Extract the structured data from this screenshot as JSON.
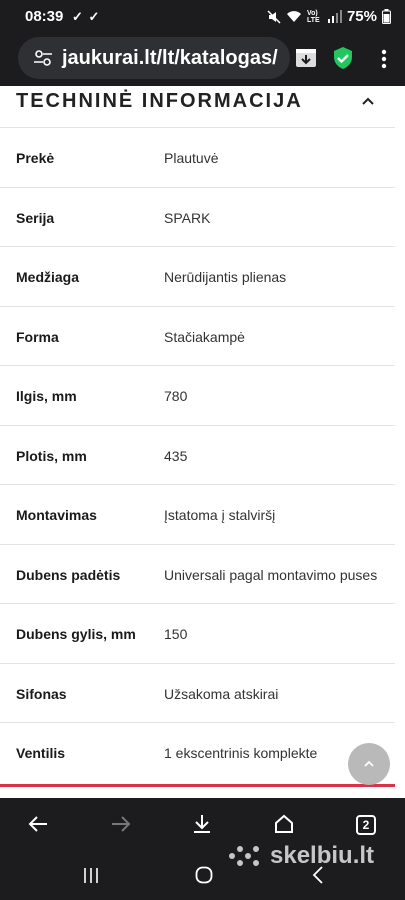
{
  "status_bar": {
    "time": "08:39",
    "notification_checks": "✓ ✓",
    "battery": "75%",
    "network_label": "Vo) LTE"
  },
  "browser": {
    "url": "jaukurai.lt/lt/katalogas/",
    "open_tabs": "2"
  },
  "section": {
    "title": "TECHNINĖ INFORMACIJA"
  },
  "specs": [
    {
      "label": "Prekė",
      "value": "Plautuvė"
    },
    {
      "label": "Serija",
      "value": "SPARK"
    },
    {
      "label": "Medžiaga",
      "value": "Nerūdijantis plienas"
    },
    {
      "label": "Forma",
      "value": "Stačiakampė"
    },
    {
      "label": "Ilgis, mm",
      "value": "780"
    },
    {
      "label": "Plotis, mm",
      "value": "435"
    },
    {
      "label": "Montavimas",
      "value": "Įstatoma į stalviršį"
    },
    {
      "label": "Dubens padėtis",
      "value": "Universali pagal montavimo puses"
    },
    {
      "label": "Dubens gylis, mm",
      "value": "150"
    },
    {
      "label": "Sifonas",
      "value": "Užsakoma atskirai"
    },
    {
      "label": "Ventilis",
      "value": "1 ekscentrinis komplekte"
    }
  ],
  "watermark": {
    "text": "skelbiu.lt"
  },
  "colors": {
    "accent": "#d9334a",
    "shield": "#22c55e",
    "browser_chrome": "#1c1c1e"
  },
  "icons": [
    "site-settings-icon",
    "download-page-icon",
    "shield-check-icon",
    "menu-dots-icon",
    "chevron-up-icon",
    "back-arrow-icon",
    "forward-arrow-icon",
    "download-icon",
    "home-icon",
    "recents-icon",
    "home-circle-icon",
    "nav-back-icon"
  ]
}
